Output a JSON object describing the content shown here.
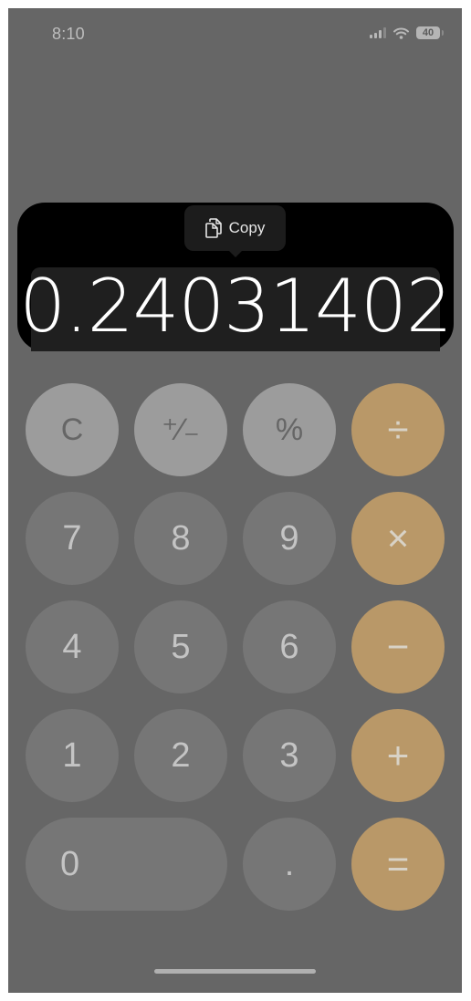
{
  "status_bar": {
    "time": "8:10",
    "battery_level": "40",
    "icons": [
      "cellular-signal-icon",
      "wifi-icon",
      "battery-icon"
    ]
  },
  "display": {
    "value": "0.24031402",
    "selected": true
  },
  "context_menu": {
    "copy_label": "Copy",
    "copy_icon": "copy-document-icon"
  },
  "keypad": {
    "rows": [
      [
        {
          "label": "C",
          "type": "func",
          "name": "clear"
        },
        {
          "label": "⁺∕₋",
          "type": "func",
          "name": "plus-minus"
        },
        {
          "label": "%",
          "type": "func",
          "name": "percent"
        },
        {
          "label": "÷",
          "type": "op",
          "name": "divide"
        }
      ],
      [
        {
          "label": "7",
          "type": "digit",
          "name": "7"
        },
        {
          "label": "8",
          "type": "digit",
          "name": "8"
        },
        {
          "label": "9",
          "type": "digit",
          "name": "9"
        },
        {
          "label": "×",
          "type": "op",
          "name": "multiply"
        }
      ],
      [
        {
          "label": "4",
          "type": "digit",
          "name": "4"
        },
        {
          "label": "5",
          "type": "digit",
          "name": "5"
        },
        {
          "label": "6",
          "type": "digit",
          "name": "6"
        },
        {
          "label": "−",
          "type": "op",
          "name": "minus"
        }
      ],
      [
        {
          "label": "1",
          "type": "digit",
          "name": "1"
        },
        {
          "label": "2",
          "type": "digit",
          "name": "2"
        },
        {
          "label": "3",
          "type": "digit",
          "name": "3"
        },
        {
          "label": "+",
          "type": "op",
          "name": "plus"
        }
      ],
      [
        {
          "label": "0",
          "type": "digit",
          "name": "0"
        },
        {
          "label": ".",
          "type": "digit",
          "name": "decimal"
        },
        {
          "label": "=",
          "type": "op",
          "name": "equals"
        }
      ]
    ]
  },
  "colors": {
    "function_key": "#9c9c9c",
    "digit_key": "#767676",
    "operator_key": "#b99868",
    "background": "#666666",
    "display_panel": "#000000"
  }
}
